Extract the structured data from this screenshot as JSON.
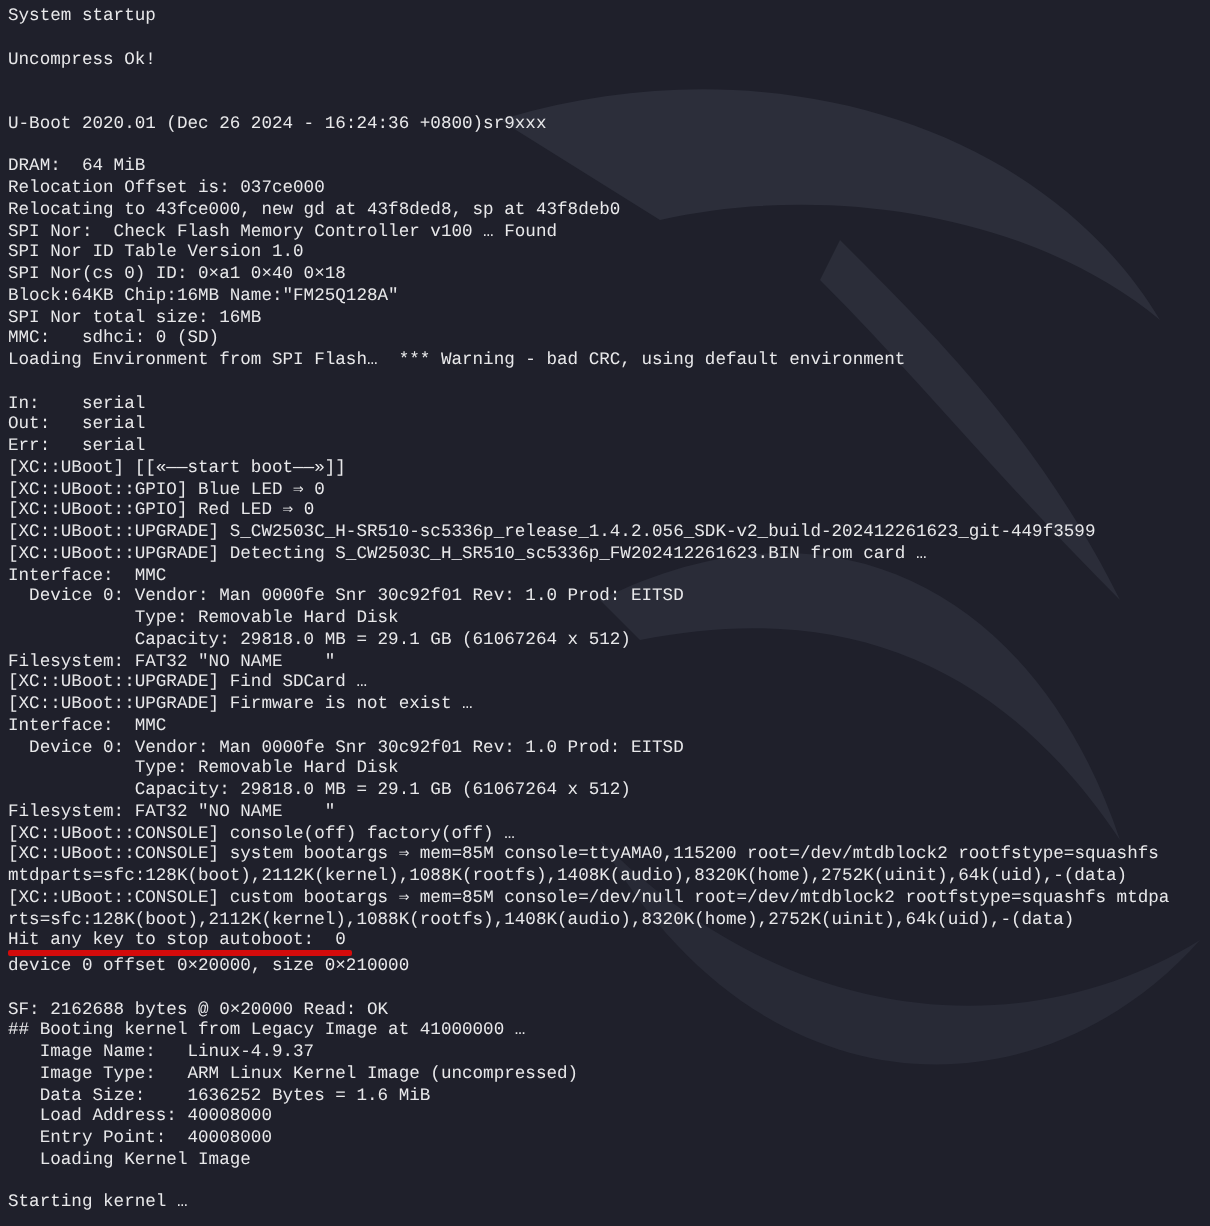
{
  "terminal": {
    "blocks": [
      {
        "lines": [
          {
            "text": "System startup"
          }
        ]
      },
      {
        "lines": [
          {
            "text": "Uncompress Ok!"
          }
        ]
      },
      {
        "lines": [
          {
            "text": "U-Boot 2020.01 (Dec 26 2024 - 16:24:36 +0800)sr9xxx"
          }
        ]
      },
      {
        "lines": [
          {
            "text": "DRAM:  64 MiB"
          },
          {
            "text": "Relocation Offset is: 037ce000"
          },
          {
            "text": "Relocating to 43fce000, new gd at 43f8ded8, sp at 43f8deb0"
          },
          {
            "text": "SPI Nor:  Check Flash Memory Controller v100 … Found"
          },
          {
            "text": "SPI Nor ID Table Version 1.0"
          },
          {
            "text": "SPI Nor(cs 0) ID: 0×a1 0×40 0×18"
          },
          {
            "text": "Block:64KB Chip:16MB Name:\"FM25Q128A\""
          },
          {
            "text": "SPI Nor total size: 16MB"
          },
          {
            "text": "MMC:   sdhci: 0 (SD)"
          },
          {
            "text": "Loading Environment from SPI Flash…  *** Warning - bad CRC, using default environment"
          }
        ]
      },
      {
        "lines": [
          {
            "text": "In:    serial"
          },
          {
            "text": "Out:   serial"
          },
          {
            "text": "Err:   serial"
          },
          {
            "text": "[XC::UBoot] [[«——start boot——»]]"
          },
          {
            "text": "[XC::UBoot::GPIO] Blue LED ⇒ 0"
          },
          {
            "text": "[XC::UBoot::GPIO] Red LED ⇒ 0"
          },
          {
            "text": "[XC::UBoot::UPGRADE] S_CW2503C_H-SR510-sc5336p_release_1.4.2.056_SDK-v2_build-202412261623_git-449f3599"
          },
          {
            "text": "[XC::UBoot::UPGRADE] Detecting S_CW2503C_H_SR510_sc5336p_FW202412261623.BIN from card …"
          },
          {
            "text": "Interface:  MMC"
          },
          {
            "text": "  Device 0: Vendor: Man 0000fe Snr 30c92f01 Rev: 1.0 Prod: EITSD"
          },
          {
            "text": "            Type: Removable Hard Disk"
          },
          {
            "text": "            Capacity: 29818.0 MB = 29.1 GB (61067264 x 512)"
          },
          {
            "text": "Filesystem: FAT32 \"NO NAME    \""
          },
          {
            "text": "[XC::UBoot::UPGRADE] Find SDCard …"
          },
          {
            "text": "[XC::UBoot::UPGRADE] Firmware is not exist …"
          },
          {
            "text": "Interface:  MMC"
          },
          {
            "text": "  Device 0: Vendor: Man 0000fe Snr 30c92f01 Rev: 1.0 Prod: EITSD"
          },
          {
            "text": "            Type: Removable Hard Disk"
          },
          {
            "text": "            Capacity: 29818.0 MB = 29.1 GB (61067264 x 512)"
          },
          {
            "text": "Filesystem: FAT32 \"NO NAME    \""
          },
          {
            "text": "[XC::UBoot::CONSOLE] console(off) factory(off) …"
          },
          {
            "text": "[XC::UBoot::CONSOLE] system bootargs ⇒ mem=85M console=ttyAMA0,115200 root=/dev/mtdblock2 rootfstype=squashfs"
          },
          {
            "text": "mtdparts=sfc:128K(boot),2112K(kernel),1088K(rootfs),1408K(audio),8320K(home),2752K(uinit),64k(uid),-(data)"
          },
          {
            "text": "[XC::UBoot::CONSOLE] custom bootargs ⇒ mem=85M console=/dev/null root=/dev/mtdblock2 rootfstype=squashfs mtdpa"
          },
          {
            "text": "rts=sfc:128K(boot),2112K(kernel),1088K(rootfs),1408K(audio),8320K(home),2752K(uinit),64k(uid),-(data)"
          },
          {
            "text": "Hit any key to stop autoboot:  0",
            "underlined": true
          },
          {
            "text": "device 0 offset 0×20000, size 0×210000"
          }
        ]
      },
      {
        "lines": [
          {
            "text": "SF: 2162688 bytes @ 0×20000 Read: OK"
          },
          {
            "text": "## Booting kernel from Legacy Image at 41000000 …"
          },
          {
            "text": "   Image Name:   Linux-4.9.37"
          },
          {
            "text": "   Image Type:   ARM Linux Kernel Image (uncompressed)"
          },
          {
            "text": "   Data Size:    1636252 Bytes = 1.6 MiB"
          },
          {
            "text": "   Load Address: 40008000"
          },
          {
            "text": "   Entry Point:  40008000"
          },
          {
            "text": "   Loading Kernel Image"
          }
        ]
      },
      {
        "lines": [
          {
            "text": "Starting kernel …"
          }
        ]
      }
    ]
  }
}
